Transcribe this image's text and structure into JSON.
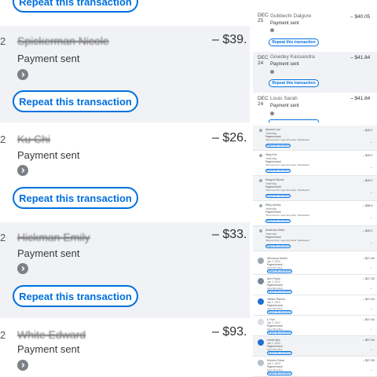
{
  "colors": {
    "accent": "#0070e0",
    "shaded_row": "#f0f2f5",
    "chevron": "#7d8187"
  },
  "icons": {
    "chevron": "chevron-right-icon",
    "status": "status-dot-icon"
  },
  "left_panel": {
    "top_button_label": "Repeat this transaction",
    "items": [
      {
        "date_edge": "2",
        "name": "Spickerman Nicole",
        "status": "Payment sent",
        "amount": "– $39.",
        "button": "Repeat this transaction"
      },
      {
        "date_edge": "2",
        "name": "Ku Chi",
        "status": "Payment sent",
        "amount": "– $26.",
        "button": "Repeat this transaction"
      },
      {
        "date_edge": "2",
        "name": "Hickman Emily",
        "status": "Payment sent",
        "amount": "– $33.",
        "button": "Repeat this transaction"
      },
      {
        "date_edge": "2",
        "name": "White Edward",
        "status": "Payment sent",
        "amount": "– $93."
      }
    ]
  },
  "right_top": {
    "items": [
      {
        "month": "DEC",
        "day": "25",
        "name": "Gubbechi Dalgore",
        "status": "Payment sent",
        "amount": "– $40.05",
        "button": "Repeat this transaction"
      },
      {
        "month": "DEC",
        "day": "24",
        "name": "Gowdey Kassandra",
        "status": "Payment sent",
        "amount": "– $41.84",
        "button": "Repeat this transaction"
      },
      {
        "month": "DEC",
        "day": "24",
        "name": "Louis Sarah",
        "status": "Payment sent",
        "amount": "– $41.84"
      }
    ]
  },
  "right_bottom": {
    "top_items": [
      {
        "name": "Ahmed Lisa",
        "when": "Yesterday",
        "status": "Payment sent",
        "note": "\"$xxxxxxxxxx\" pays bill online \"blackhawk\"",
        "amount": "– $15.7",
        "button": "Repeat this transaction"
      },
      {
        "name": "Ning Kim",
        "when": "Yesterday",
        "status": "Payment sent",
        "note": "\"$xxxxxxxxxx\" pays bill online \"blackhawk\"",
        "amount": "– $15.7",
        "button": "Repeat this transaction"
      },
      {
        "name": "Mingeni Nicole",
        "when": "Yesterday",
        "status": "Payment sent",
        "note": "\"$xxxxxxxxxx\" pays bill online \"blackhawk\"",
        "amount": "– $15.7",
        "button": "Repeat this transaction"
      },
      {
        "name": "Riley Ashley",
        "when": "Yesterday",
        "status": "Payment sent",
        "note": "\"$xxxxxxxxxx\" pays bill online \"blackhawk\"",
        "amount": "– $38.4",
        "button": "Repeat this transaction"
      },
      {
        "name": "Anderson Mark",
        "when": "Yesterday",
        "status": "Payment sent",
        "note": "\"$xxxxxxxxxx\" pays bill online \"blackhawk\"",
        "amount": "– $15.7",
        "button": "Repeat this transaction"
      }
    ],
    "list_items": [
      {
        "name": "Mendoza Hector",
        "when": "Jan 2, 2024",
        "status": "Payment sent",
        "note": "pays bill online",
        "amount": "– $17.44",
        "button": "Repeat this transaction",
        "avatar": "#9aa6b3"
      },
      {
        "name": "Ahn Paula",
        "when": "Jan 2, 2024",
        "status": "Payment sent",
        "note": "pays bill online",
        "amount": "– $17.20",
        "button": "Repeat this transaction",
        "avatar": "#7a8594"
      },
      {
        "name": "Valdez Ramon",
        "when": "Jan 2, 2024",
        "status": "Payment sent",
        "note": "pays bill online",
        "amount": "– $17.44",
        "button": "Repeat this transaction",
        "avatar": "#1f6fd1"
      },
      {
        "name": "Li Yun",
        "when": "Jan 2, 2024",
        "status": "Payment sent",
        "note": "pays bill online",
        "amount": "– $17.44",
        "button": "Repeat this transaction",
        "avatar": "#d8dde3"
      },
      {
        "name": "Harris Ben",
        "when": "Jan 2, 2024",
        "status": "Payment sent",
        "note": "pays bill online",
        "amount": "– $17.44",
        "button": "Repeat this transaction",
        "avatar": "#1f6fd1"
      },
      {
        "name": "Moreno Dana",
        "when": "Jan 2, 2024",
        "status": "Payment sent",
        "note": "pays bill online",
        "amount": "– $17.05",
        "button": "Repeat this transaction",
        "avatar": "#b8c0c9"
      }
    ]
  }
}
